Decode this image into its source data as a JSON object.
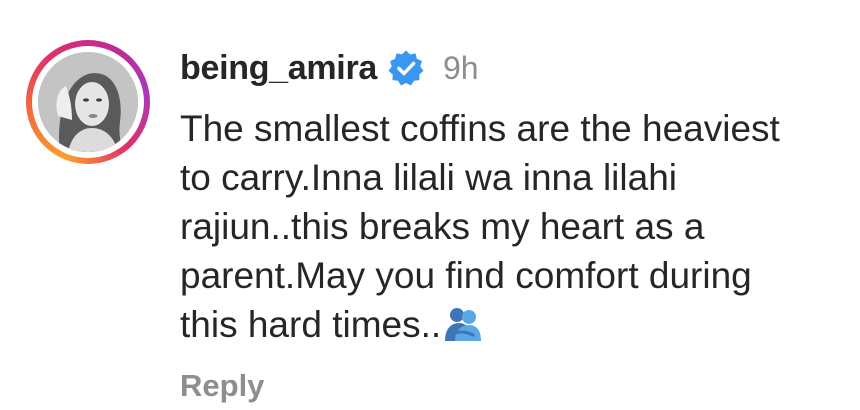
{
  "comment": {
    "username": "being_amira",
    "verified": true,
    "time": "9h",
    "text_lines": [
      "The smallest coffins are the heaviest",
      "to carry.Inna lilali wa inna lilahi",
      "rajiun..this breaks my heart as a",
      "parent.May you find comfort during",
      "this hard times.."
    ],
    "emoji": "people-hugging-emoji",
    "reply_label": "Reply"
  },
  "colors": {
    "text": "#262626",
    "muted": "#8e8e8e",
    "verified_blue": "#3897f0",
    "story_ring": [
      "#f9a02b",
      "#e0306a",
      "#a839b8"
    ]
  },
  "icons": {
    "verified": "verified-badge-icon",
    "avatar": "profile-avatar"
  }
}
